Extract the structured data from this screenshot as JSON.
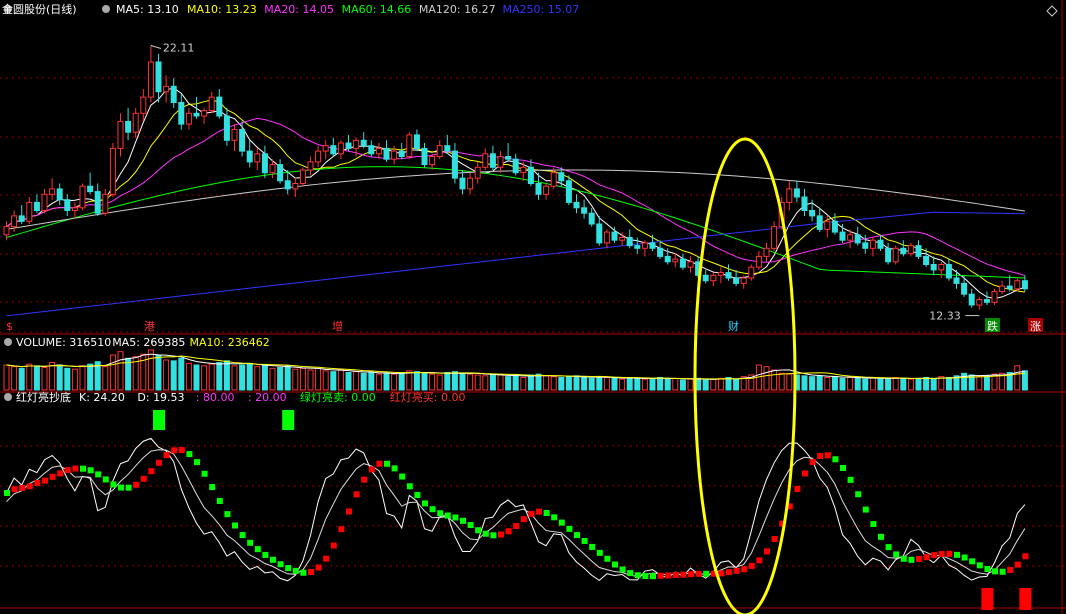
{
  "window": {
    "maximize_icon": "diamond-icon"
  },
  "panels": {
    "price": {
      "title": "金圆股份(日线)",
      "indicators": [
        {
          "label": "MA5: 13.10",
          "color": "#ffffff"
        },
        {
          "label": "MA10: 13.23",
          "color": "#ffff00"
        },
        {
          "label": "MA20: 14.05",
          "color": "#ff33ff"
        },
        {
          "label": "MA60: 14.66",
          "color": "#00ff00"
        },
        {
          "label": "MA120: 16.27",
          "color": "#cccccc"
        },
        {
          "label": "MA250: 15.07",
          "color": "#3333ff"
        }
      ],
      "high_label": "22.11",
      "low_label": "12.33",
      "event_markers": [
        {
          "text": "$",
          "color": "#ff3333",
          "bg": "#000000"
        },
        {
          "text": "港",
          "color": "#ff3333",
          "bg": "#000000"
        },
        {
          "text": "增",
          "color": "#ff3333",
          "bg": "#000000"
        },
        {
          "text": "财",
          "color": "#33ccff",
          "bg": "#000000"
        },
        {
          "text": "跌",
          "color": "#ffffff",
          "bg": "#008800"
        },
        {
          "text": "涨",
          "color": "#ffffff",
          "bg": "#aa0000"
        }
      ]
    },
    "volume": {
      "indicators": [
        {
          "label": "VOLUME: 316510",
          "color": "#ffffff"
        },
        {
          "label": "MA5: 269385",
          "color": "#ffffff"
        },
        {
          "label": "MA10: 236462",
          "color": "#ffff00"
        }
      ]
    },
    "oscillator": {
      "indicators": [
        {
          "label": "红灯亮抄底",
          "color": "#ffffff"
        },
        {
          "label": "K: 24.20",
          "color": "#ffffff"
        },
        {
          "label": "D: 19.53",
          "color": "#ffffff"
        },
        {
          "label": ": 80.00",
          "color": "#ff33ff"
        },
        {
          "label": ": 20.00",
          "color": "#ff33ff"
        },
        {
          "label": "绿灯亮卖: 0.00",
          "color": "#00ff00"
        },
        {
          "label": "红灯亮买: 0.00",
          "color": "#ff3333"
        }
      ]
    }
  },
  "colors": {
    "up": "#ff3333",
    "down": "#33e0e0",
    "grid": "#8b0000",
    "ellipse": "#ffff00",
    "green_light": "#00ff00",
    "red_light": "#ff0000"
  },
  "chart_data": [
    {
      "type": "candlestick",
      "title": "金圆股份(日线)",
      "ylim": [
        11.5,
        23.5
      ],
      "series": [
        {
          "name": "MA5",
          "key": "ma5"
        },
        {
          "name": "MA10",
          "key": "ma10"
        },
        {
          "name": "MA20",
          "key": "ma20"
        },
        {
          "name": "MA60",
          "key": "ma60"
        },
        {
          "name": "MA120",
          "key": "ma120"
        },
        {
          "name": "MA250",
          "key": "ma250"
        }
      ],
      "ohlc": [
        [
          15.1,
          15.6,
          14.9,
          15.4
        ],
        [
          15.4,
          16.0,
          15.2,
          15.8
        ],
        [
          15.8,
          16.2,
          15.5,
          15.6
        ],
        [
          15.6,
          16.5,
          15.5,
          16.3
        ],
        [
          16.3,
          16.6,
          15.9,
          16.0
        ],
        [
          16.0,
          16.8,
          15.9,
          16.6
        ],
        [
          16.6,
          17.2,
          16.4,
          16.8
        ],
        [
          16.8,
          17.0,
          16.2,
          16.4
        ],
        [
          16.4,
          16.6,
          15.8,
          16.0
        ],
        [
          16.0,
          16.3,
          15.7,
          16.1
        ],
        [
          16.1,
          17.0,
          16.0,
          16.9
        ],
        [
          16.9,
          17.4,
          16.6,
          16.7
        ],
        [
          16.7,
          17.0,
          15.8,
          15.9
        ],
        [
          15.9,
          16.8,
          15.8,
          16.6
        ],
        [
          16.6,
          18.5,
          16.5,
          18.3
        ],
        [
          18.3,
          19.6,
          18.0,
          19.3
        ],
        [
          19.3,
          19.8,
          18.6,
          18.9
        ],
        [
          18.9,
          19.8,
          18.7,
          19.6
        ],
        [
          19.6,
          20.5,
          19.3,
          20.2
        ],
        [
          20.2,
          22.11,
          20.0,
          21.5
        ],
        [
          21.5,
          21.8,
          20.0,
          20.4
        ],
        [
          20.4,
          21.0,
          20.0,
          20.6
        ],
        [
          20.6,
          20.9,
          19.8,
          20.0
        ],
        [
          20.0,
          20.3,
          19.0,
          19.2
        ],
        [
          19.2,
          19.8,
          19.0,
          19.6
        ],
        [
          19.6,
          20.2,
          19.4,
          19.5
        ],
        [
          19.5,
          19.8,
          19.2,
          19.7
        ],
        [
          19.7,
          20.4,
          19.6,
          20.2
        ],
        [
          20.2,
          20.5,
          19.4,
          19.5
        ],
        [
          19.5,
          19.8,
          18.4,
          18.6
        ],
        [
          18.6,
          19.2,
          18.2,
          19.0
        ],
        [
          19.0,
          19.3,
          18.0,
          18.2
        ],
        [
          18.2,
          18.6,
          17.6,
          17.8
        ],
        [
          17.8,
          18.3,
          17.5,
          18.1
        ],
        [
          18.1,
          18.4,
          17.2,
          17.4
        ],
        [
          17.4,
          17.9,
          17.2,
          17.7
        ],
        [
          17.7,
          17.9,
          17.0,
          17.1
        ],
        [
          17.1,
          17.5,
          16.6,
          16.8
        ],
        [
          16.8,
          17.2,
          16.5,
          17.0
        ],
        [
          17.0,
          17.6,
          16.9,
          17.5
        ],
        [
          17.5,
          18.0,
          17.3,
          17.8
        ],
        [
          17.8,
          18.4,
          17.6,
          18.2
        ],
        [
          18.2,
          18.6,
          17.9,
          18.4
        ],
        [
          18.4,
          18.7,
          18.0,
          18.1
        ],
        [
          18.1,
          18.6,
          17.9,
          18.5
        ],
        [
          18.5,
          18.8,
          18.2,
          18.3
        ],
        [
          18.3,
          18.7,
          18.0,
          18.6
        ],
        [
          18.6,
          18.9,
          18.3,
          18.4
        ],
        [
          18.4,
          18.6,
          18.0,
          18.1
        ],
        [
          18.1,
          18.5,
          17.9,
          18.3
        ],
        [
          18.3,
          18.6,
          17.8,
          17.9
        ],
        [
          17.9,
          18.4,
          17.7,
          18.2
        ],
        [
          18.2,
          18.5,
          17.9,
          18.0
        ],
        [
          18.0,
          18.9,
          17.9,
          18.8
        ],
        [
          18.8,
          19.0,
          18.2,
          18.3
        ],
        [
          18.3,
          18.5,
          17.6,
          17.7
        ],
        [
          17.7,
          18.1,
          17.5,
          18.0
        ],
        [
          18.0,
          18.6,
          17.9,
          18.4
        ],
        [
          18.4,
          18.8,
          18.1,
          18.2
        ],
        [
          18.2,
          18.5,
          17.0,
          17.2
        ],
        [
          17.2,
          17.5,
          16.6,
          16.8
        ],
        [
          16.8,
          17.4,
          16.6,
          17.2
        ],
        [
          17.2,
          17.8,
          17.0,
          17.6
        ],
        [
          17.6,
          18.3,
          17.5,
          18.1
        ],
        [
          18.1,
          18.4,
          17.5,
          17.6
        ],
        [
          17.6,
          18.2,
          17.4,
          18.0
        ],
        [
          18.0,
          18.5,
          17.8,
          17.9
        ],
        [
          17.9,
          18.1,
          17.3,
          17.4
        ],
        [
          17.4,
          17.8,
          17.1,
          17.6
        ],
        [
          17.6,
          17.9,
          16.9,
          17.0
        ],
        [
          17.0,
          17.4,
          16.4,
          16.6
        ],
        [
          16.6,
          17.0,
          16.4,
          16.9
        ],
        [
          16.9,
          17.6,
          16.8,
          17.4
        ],
        [
          17.4,
          17.6,
          16.9,
          17.1
        ],
        [
          17.1,
          17.3,
          16.2,
          16.3
        ],
        [
          16.3,
          16.6,
          15.9,
          16.1
        ],
        [
          16.1,
          16.4,
          15.7,
          15.9
        ],
        [
          15.9,
          16.1,
          15.4,
          15.5
        ],
        [
          15.5,
          15.8,
          14.7,
          14.8
        ],
        [
          14.8,
          15.3,
          14.6,
          15.2
        ],
        [
          15.2,
          15.4,
          14.8,
          14.9
        ],
        [
          14.9,
          15.2,
          14.7,
          15.0
        ],
        [
          15.0,
          15.3,
          14.6,
          14.7
        ],
        [
          14.7,
          15.0,
          14.4,
          14.6
        ],
        [
          14.6,
          14.9,
          14.3,
          14.8
        ],
        [
          14.8,
          15.1,
          14.5,
          14.6
        ],
        [
          14.6,
          14.9,
          14.2,
          14.3
        ],
        [
          14.3,
          14.6,
          14.0,
          14.1
        ],
        [
          14.1,
          14.4,
          13.9,
          14.2
        ],
        [
          14.2,
          14.4,
          13.8,
          13.9
        ],
        [
          13.9,
          14.3,
          13.7,
          14.1
        ],
        [
          14.1,
          14.3,
          13.5,
          13.6
        ],
        [
          13.6,
          13.8,
          13.3,
          13.4
        ],
        [
          13.4,
          13.7,
          13.2,
          13.6
        ],
        [
          13.6,
          13.9,
          13.3,
          13.7
        ],
        [
          13.7,
          14.0,
          13.4,
          13.5
        ],
        [
          13.5,
          13.8,
          13.2,
          13.3
        ],
        [
          13.3,
          13.6,
          13.1,
          13.5
        ],
        [
          13.5,
          14.0,
          13.4,
          13.9
        ],
        [
          13.9,
          14.5,
          13.8,
          14.3
        ],
        [
          14.3,
          14.8,
          14.1,
          14.6
        ],
        [
          14.6,
          15.6,
          14.5,
          15.4
        ],
        [
          15.4,
          16.5,
          15.3,
          16.3
        ],
        [
          16.3,
          17.1,
          16.0,
          16.8
        ],
        [
          16.8,
          17.1,
          16.3,
          16.5
        ],
        [
          16.5,
          16.8,
          15.8,
          16.0
        ],
        [
          16.0,
          16.4,
          15.6,
          15.8
        ],
        [
          15.8,
          16.1,
          15.2,
          15.3
        ],
        [
          15.3,
          15.8,
          15.0,
          15.6
        ],
        [
          15.6,
          15.9,
          15.1,
          15.2
        ],
        [
          15.2,
          15.5,
          14.8,
          14.9
        ],
        [
          14.9,
          15.3,
          14.6,
          15.1
        ],
        [
          15.1,
          15.4,
          14.7,
          14.8
        ],
        [
          14.8,
          15.1,
          14.4,
          14.6
        ],
        [
          14.6,
          15.0,
          14.3,
          14.9
        ],
        [
          14.9,
          15.1,
          14.5,
          14.6
        ],
        [
          14.6,
          14.8,
          14.0,
          14.1
        ],
        [
          14.1,
          14.7,
          14.0,
          14.6
        ],
        [
          14.6,
          14.9,
          14.3,
          14.4
        ],
        [
          14.4,
          14.8,
          14.3,
          14.7
        ],
        [
          14.7,
          14.9,
          14.2,
          14.3
        ],
        [
          14.3,
          14.6,
          13.9,
          14.0
        ],
        [
          14.0,
          14.3,
          13.6,
          13.8
        ],
        [
          13.8,
          14.1,
          13.5,
          14.0
        ],
        [
          14.0,
          14.2,
          13.4,
          13.5
        ],
        [
          13.5,
          13.8,
          13.1,
          13.3
        ],
        [
          13.3,
          13.6,
          12.8,
          12.9
        ],
        [
          12.9,
          13.1,
          12.4,
          12.5
        ],
        [
          12.5,
          12.8,
          12.33,
          12.7
        ],
        [
          12.7,
          13.0,
          12.5,
          12.6
        ],
        [
          12.6,
          13.1,
          12.5,
          13.0
        ],
        [
          13.0,
          13.4,
          12.9,
          13.2
        ],
        [
          13.2,
          13.6,
          13.0,
          13.1
        ],
        [
          13.1,
          13.5,
          13.0,
          13.4
        ],
        [
          13.4,
          13.6,
          13.0,
          13.1
        ]
      ],
      "volume": [
        300,
        280,
        260,
        310,
        290,
        270,
        330,
        300,
        260,
        250,
        290,
        310,
        340,
        280,
        420,
        460,
        380,
        400,
        430,
        480,
        420,
        360,
        350,
        380,
        320,
        300,
        290,
        310,
        330,
        350,
        290,
        300,
        320,
        280,
        300,
        260,
        270,
        290,
        250,
        260,
        240,
        260,
        230,
        220,
        240,
        210,
        220,
        200,
        210,
        190,
        200,
        190,
        210,
        230,
        220,
        200,
        190,
        180,
        210,
        220,
        200,
        190,
        180,
        170,
        190,
        180,
        160,
        170,
        150,
        180,
        190,
        170,
        160,
        150,
        160,
        170,
        150,
        140,
        160,
        150,
        140,
        130,
        150,
        140,
        130,
        140,
        150,
        130,
        140,
        120,
        130,
        140,
        120,
        130,
        140,
        150,
        130,
        160,
        180,
        300,
        280,
        240,
        200,
        190,
        180,
        170,
        160,
        170,
        150,
        160,
        140,
        150,
        140,
        130,
        150,
        140,
        130,
        150,
        140,
        130,
        140,
        150,
        130,
        160,
        150,
        170,
        200,
        180,
        160,
        170,
        190,
        200,
        210,
        290,
        230
      ]
    },
    {
      "type": "line",
      "title": "红灯亮抄底",
      "ylim": [
        -5,
        105
      ],
      "series": [
        {
          "name": "K",
          "key": "k"
        },
        {
          "name": "D",
          "key": "d"
        }
      ],
      "green_light_bars": [
        20,
        37
      ],
      "red_light_bars": [
        129,
        134
      ],
      "reference_levels": [
        80,
        20
      ]
    }
  ]
}
